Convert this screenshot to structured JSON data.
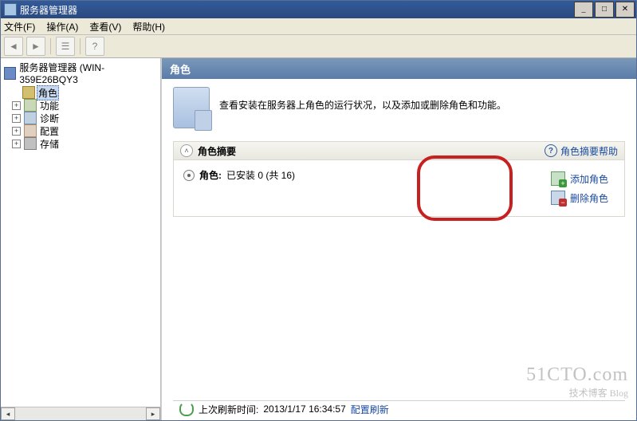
{
  "title": "服务器管理器",
  "menu": {
    "file": "文件(F)",
    "action": "操作(A)",
    "view": "查看(V)",
    "help": "帮助(H)"
  },
  "tree": {
    "root": "服务器管理器 (WIN-359E26BQY3",
    "items": [
      {
        "label": "角色"
      },
      {
        "label": "功能"
      },
      {
        "label": "诊断"
      },
      {
        "label": "配置"
      },
      {
        "label": "存储"
      }
    ]
  },
  "content": {
    "header": "角色",
    "description": "查看安装在服务器上角色的运行状况，以及添加或删除角色和功能。",
    "summary_title": "角色摘要",
    "summary_help": "角色摘要帮助",
    "roles_label": "角色:",
    "roles_installed": "已安装 0 (共 16)",
    "add_role": "添加角色",
    "remove_role": "删除角色"
  },
  "status": {
    "prefix": "上次刷新时间:",
    "time": "2013/1/17 16:34:57",
    "refresh": "配置刷新"
  },
  "watermark": {
    "l1": "51CTO.com",
    "l2": "技术博客   Blog"
  }
}
